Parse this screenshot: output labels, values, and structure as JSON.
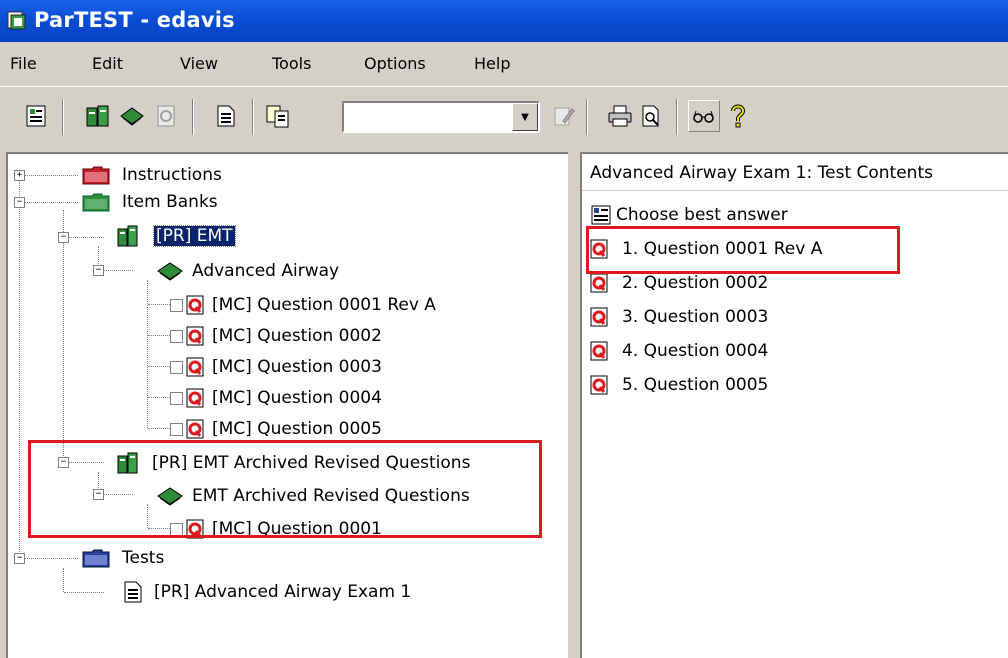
{
  "window": {
    "title": "ParTEST - edavis",
    "app_icon": "partest-app-icon"
  },
  "menu": [
    "File",
    "Edit",
    "View",
    "Tools",
    "Options",
    "Help"
  ],
  "toolbar": {
    "combo_value": "",
    "buttons": [
      "properties-icon",
      "item-bank-icon",
      "book-icon",
      "question-icon",
      "document-icon",
      "copy-document-icon",
      "edit-icon",
      "print-icon",
      "print-preview-icon",
      "glasses-icon",
      "help-icon"
    ]
  },
  "tree": {
    "instructions": "Instructions",
    "item_banks": "Item Banks",
    "emt_bank": "[PR] EMT",
    "advanced_airway": "Advanced Airway",
    "questions": [
      "[MC] Question 0001 Rev A",
      "[MC] Question 0002",
      "[MC] Question 0003",
      "[MC] Question 0004",
      "[MC] Question 0005"
    ],
    "archived_bank": "[PR] EMT Archived Revised Questions",
    "archived_book": "EMT Archived Revised Questions",
    "archived_question": "[MC] Question 0001",
    "tests": "Tests",
    "test_item": "[PR] Advanced Airway Exam 1"
  },
  "test_contents": {
    "header": "Advanced Airway Exam 1: Test Contents",
    "group_label": "Choose best answer",
    "items": [
      "1. Question 0001 Rev A",
      "2. Question 0002",
      "3. Question 0003",
      "4. Question 0004",
      "5. Question 0005"
    ]
  },
  "colors": {
    "titlebar": "#0a4fd6",
    "selection": "#0a246a",
    "highlight": "#e0191f",
    "folder_red": "#c0202a",
    "folder_green": "#2f8a3a",
    "folder_blue": "#2a3f9a"
  }
}
